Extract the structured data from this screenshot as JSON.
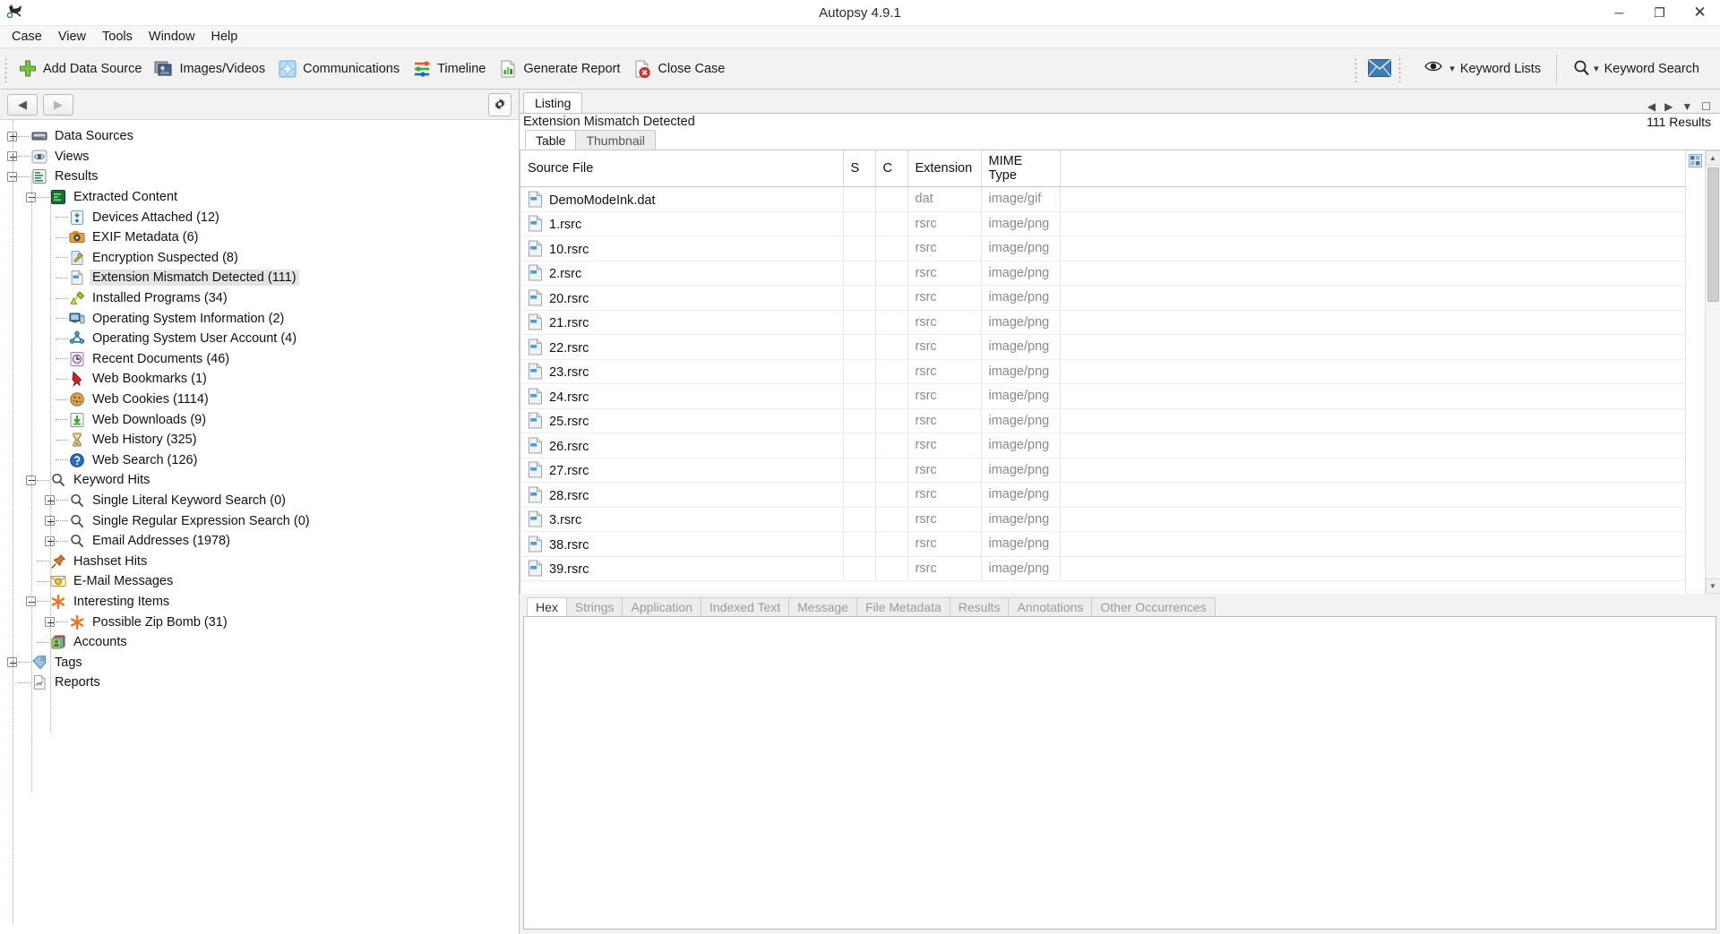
{
  "window": {
    "title": "Autopsy 4.9.1",
    "app_icon": "autopsy-logo-icon",
    "minimize": "─",
    "maximize": "❐",
    "close": "✕"
  },
  "menubar": {
    "items": [
      {
        "label": "Case",
        "name": "menu-case"
      },
      {
        "label": "View",
        "name": "menu-view"
      },
      {
        "label": "Tools",
        "name": "menu-tools"
      },
      {
        "label": "Window",
        "name": "menu-window"
      },
      {
        "label": "Help",
        "name": "menu-help"
      }
    ]
  },
  "toolbar": {
    "buttons": [
      {
        "label": "Add Data Source",
        "icon": "green-plus-icon",
        "name": "add-data-source-button"
      },
      {
        "label": "Images/Videos",
        "icon": "images-videos-icon",
        "name": "images-videos-button"
      },
      {
        "label": "Communications",
        "icon": "communications-icon",
        "name": "communications-button"
      },
      {
        "label": "Timeline",
        "icon": "timeline-icon",
        "name": "timeline-button"
      },
      {
        "label": "Generate Report",
        "icon": "report-icon",
        "name": "generate-report-button"
      },
      {
        "label": "Close Case",
        "icon": "close-case-icon",
        "name": "close-case-button"
      }
    ],
    "mail_icon": "envelope-icon",
    "keyword_lists": {
      "label": "Keyword Lists",
      "icon": "eye-icon",
      "caret": "▾"
    },
    "keyword_search": {
      "label": "Keyword Search",
      "icon": "magnifier-icon",
      "caret": "▾"
    }
  },
  "navigator": {
    "back_arrow": "◀",
    "forward_arrow": "▶",
    "gear_icon": "gear-icon",
    "tree": [
      {
        "label": "Data Sources",
        "icon": "drive-icon",
        "depth": 0,
        "toggle": "plus",
        "selected": false
      },
      {
        "label": "Views",
        "icon": "eye-view-icon",
        "depth": 0,
        "toggle": "plus",
        "selected": false
      },
      {
        "label": "Results",
        "icon": "results-icon",
        "depth": 0,
        "toggle": "minus",
        "selected": false
      },
      {
        "label": "Extracted Content",
        "icon": "extracted-content-icon",
        "depth": 1,
        "toggle": "minus",
        "selected": false
      },
      {
        "label": "Devices Attached (12)",
        "icon": "device-icon",
        "depth": 2,
        "toggle": "none",
        "selected": false
      },
      {
        "label": "EXIF Metadata (6)",
        "icon": "camera-icon",
        "depth": 2,
        "toggle": "none",
        "selected": false
      },
      {
        "label": "Encryption Suspected (8)",
        "icon": "encryption-icon",
        "depth": 2,
        "toggle": "none",
        "selected": false
      },
      {
        "label": "Extension Mismatch Detected (111)",
        "icon": "file-mismatch-icon",
        "depth": 2,
        "toggle": "none",
        "selected": true
      },
      {
        "label": "Installed Programs (34)",
        "icon": "installed-programs-icon",
        "depth": 2,
        "toggle": "none",
        "selected": false
      },
      {
        "label": "Operating System Information (2)",
        "icon": "computer-icon",
        "depth": 2,
        "toggle": "none",
        "selected": false
      },
      {
        "label": "Operating System User Account (4)",
        "icon": "user-account-icon",
        "depth": 2,
        "toggle": "none",
        "selected": false
      },
      {
        "label": "Recent Documents (46)",
        "icon": "recent-documents-icon",
        "depth": 2,
        "toggle": "none",
        "selected": false
      },
      {
        "label": "Web Bookmarks (1)",
        "icon": "bookmark-icon",
        "depth": 2,
        "toggle": "none",
        "selected": false
      },
      {
        "label": "Web Cookies (1114)",
        "icon": "cookie-icon",
        "depth": 2,
        "toggle": "none",
        "selected": false
      },
      {
        "label": "Web Downloads (9)",
        "icon": "download-icon",
        "depth": 2,
        "toggle": "none",
        "selected": false
      },
      {
        "label": "Web History (325)",
        "icon": "hourglass-icon",
        "depth": 2,
        "toggle": "none",
        "selected": false
      },
      {
        "label": "Web Search (126)",
        "icon": "web-search-icon",
        "depth": 2,
        "toggle": "none",
        "selected": false
      },
      {
        "label": "Keyword Hits",
        "icon": "magnifier-icon",
        "depth": 1,
        "toggle": "minus",
        "selected": false
      },
      {
        "label": "Single Literal Keyword Search (0)",
        "icon": "magnifier-icon",
        "depth": 2,
        "toggle": "plus",
        "selected": false
      },
      {
        "label": "Single Regular Expression Search (0)",
        "icon": "magnifier-icon",
        "depth": 2,
        "toggle": "plus",
        "selected": false
      },
      {
        "label": "Email Addresses (1978)",
        "icon": "magnifier-icon",
        "depth": 2,
        "toggle": "plus",
        "selected": false
      },
      {
        "label": "Hashset Hits",
        "icon": "pushpin-icon",
        "depth": 1,
        "toggle": "none",
        "selected": false
      },
      {
        "label": "E-Mail Messages",
        "icon": "email-message-icon",
        "depth": 1,
        "toggle": "none",
        "selected": false
      },
      {
        "label": "Interesting Items",
        "icon": "asterisk-icon",
        "depth": 1,
        "toggle": "minus",
        "selected": false
      },
      {
        "label": "Possible Zip Bomb (31)",
        "icon": "asterisk-icon",
        "depth": 2,
        "toggle": "plus",
        "selected": false
      },
      {
        "label": "Accounts",
        "icon": "accounts-icon",
        "depth": 1,
        "toggle": "none",
        "selected": false
      },
      {
        "label": "Tags",
        "icon": "tags-icon",
        "depth": 0,
        "toggle": "plus",
        "selected": false
      },
      {
        "label": "Reports",
        "icon": "reports-icon",
        "depth": 0,
        "toggle": "none",
        "selected": false
      }
    ]
  },
  "listing": {
    "tab_label": "Listing",
    "title": "Extension Mismatch Detected",
    "results_count": "111 Results",
    "view_tabs": [
      {
        "label": "Table",
        "active": true,
        "name": "tab-table"
      },
      {
        "label": "Thumbnail",
        "active": false,
        "name": "tab-thumbnail"
      }
    ],
    "columns": [
      "Source File",
      "S",
      "C",
      "Extension",
      "MIME Type"
    ],
    "rows": [
      {
        "source_file": "DemoModeInk.dat",
        "s": "",
        "c": "",
        "extension": "dat",
        "mime": "image/gif"
      },
      {
        "source_file": "1.rsrc",
        "s": "",
        "c": "",
        "extension": "rsrc",
        "mime": "image/png"
      },
      {
        "source_file": "10.rsrc",
        "s": "",
        "c": "",
        "extension": "rsrc",
        "mime": "image/png"
      },
      {
        "source_file": "2.rsrc",
        "s": "",
        "c": "",
        "extension": "rsrc",
        "mime": "image/png"
      },
      {
        "source_file": "20.rsrc",
        "s": "",
        "c": "",
        "extension": "rsrc",
        "mime": "image/png"
      },
      {
        "source_file": "21.rsrc",
        "s": "",
        "c": "",
        "extension": "rsrc",
        "mime": "image/png"
      },
      {
        "source_file": "22.rsrc",
        "s": "",
        "c": "",
        "extension": "rsrc",
        "mime": "image/png"
      },
      {
        "source_file": "23.rsrc",
        "s": "",
        "c": "",
        "extension": "rsrc",
        "mime": "image/png"
      },
      {
        "source_file": "24.rsrc",
        "s": "",
        "c": "",
        "extension": "rsrc",
        "mime": "image/png"
      },
      {
        "source_file": "25.rsrc",
        "s": "",
        "c": "",
        "extension": "rsrc",
        "mime": "image/png"
      },
      {
        "source_file": "26.rsrc",
        "s": "",
        "c": "",
        "extension": "rsrc",
        "mime": "image/png"
      },
      {
        "source_file": "27.rsrc",
        "s": "",
        "c": "",
        "extension": "rsrc",
        "mime": "image/png"
      },
      {
        "source_file": "28.rsrc",
        "s": "",
        "c": "",
        "extension": "rsrc",
        "mime": "image/png"
      },
      {
        "source_file": "3.rsrc",
        "s": "",
        "c": "",
        "extension": "rsrc",
        "mime": "image/png"
      },
      {
        "source_file": "38.rsrc",
        "s": "",
        "c": "",
        "extension": "rsrc",
        "mime": "image/png"
      },
      {
        "source_file": "39.rsrc",
        "s": "",
        "c": "",
        "extension": "rsrc",
        "mime": "image/png"
      }
    ]
  },
  "content_viewer": {
    "tabs": [
      {
        "label": "Hex",
        "active": true,
        "name": "tab-hex"
      },
      {
        "label": "Strings",
        "active": false,
        "name": "tab-strings"
      },
      {
        "label": "Application",
        "active": false,
        "name": "tab-application"
      },
      {
        "label": "Indexed Text",
        "active": false,
        "name": "tab-indexed-text"
      },
      {
        "label": "Message",
        "active": false,
        "name": "tab-message"
      },
      {
        "label": "File Metadata",
        "active": false,
        "name": "tab-file-metadata"
      },
      {
        "label": "Results",
        "active": false,
        "name": "tab-results"
      },
      {
        "label": "Annotations",
        "active": false,
        "name": "tab-annotations"
      },
      {
        "label": "Other Occurrences",
        "active": false,
        "name": "tab-other-occurrences"
      }
    ]
  },
  "colors": {
    "accent_blue": "#3a6ea5",
    "green": "#6ac259",
    "orange": "#ef6c23",
    "toolbar_bg": "#f2f2f2",
    "selection": "#e4e4e4"
  }
}
